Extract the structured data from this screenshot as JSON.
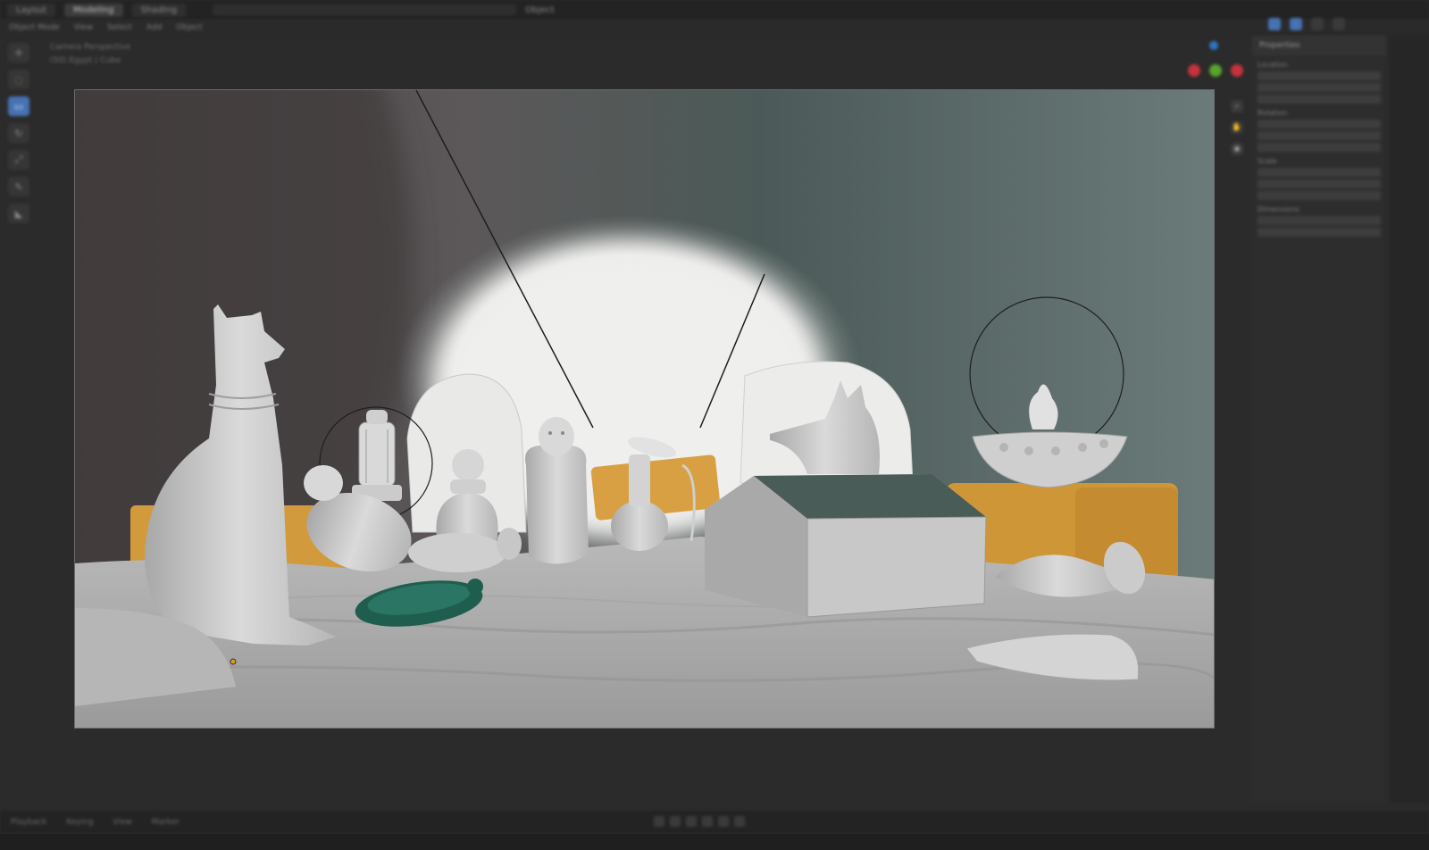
{
  "topbar": {
    "tabs": [
      "Layout",
      "Modeling",
      "Shading"
    ],
    "active_tab": "Modeling",
    "mode_label": "Object"
  },
  "headerbar": {
    "items": [
      "Object Mode",
      "View",
      "Select",
      "Add",
      "Object"
    ]
  },
  "viewport_overlay": {
    "line1": "Camera Perspective",
    "line2": "(50) Egypt | Cube"
  },
  "toolbar": {
    "tools": [
      "cursor-icon",
      "select-icon",
      "move-icon",
      "rotate-icon",
      "scale-icon",
      "annotate-icon",
      "measure-icon"
    ]
  },
  "sidepanel": {
    "header": "Properties",
    "sections": [
      "Location",
      "Rotation",
      "Scale",
      "Dimensions"
    ]
  },
  "statusbar": {
    "items": [
      "Playback",
      "Keying",
      "View",
      "Marker"
    ]
  },
  "colors": {
    "accent": "#4772b3",
    "sand": "#9a9a9a",
    "crate": "#d49a3a",
    "scarab": "#1f5e4f",
    "wall_dark": "#3e3b3c",
    "wall_teal": "#5a6b68"
  },
  "gizmo": {
    "x_color": "#c8323c",
    "y_color": "#5aa32c",
    "z_color": "#2f75c4"
  }
}
